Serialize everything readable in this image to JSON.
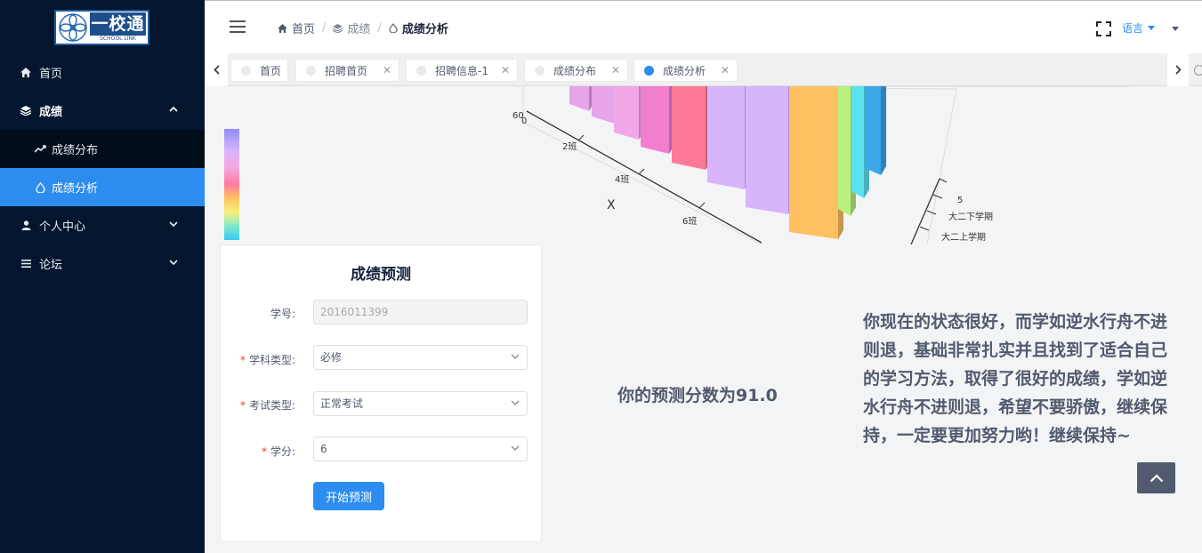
{
  "logo": {
    "main_text": "一校通",
    "sub_text": "SCHOOL LINK"
  },
  "sidebar": {
    "items": [
      {
        "label": "首页",
        "icon": "home-icon"
      },
      {
        "label": "成绩",
        "icon": "layers-icon"
      },
      {
        "label": "成绩分布",
        "icon": "trend-icon"
      },
      {
        "label": "成绩分析",
        "icon": "drop-icon"
      },
      {
        "label": "个人中心",
        "icon": "user-icon"
      },
      {
        "label": "论坛",
        "icon": "list-icon"
      }
    ]
  },
  "header": {
    "breadcrumb": [
      "首页",
      "成绩",
      "成绩分析"
    ],
    "language_label": "语言"
  },
  "tabs": [
    {
      "label": "首页",
      "active": false
    },
    {
      "label": "招聘首页",
      "active": false
    },
    {
      "label": "招聘信息-1",
      "active": false
    },
    {
      "label": "成绩分布",
      "active": false
    },
    {
      "label": "成绩分析",
      "active": true
    }
  ],
  "chart": {
    "z_tick_top": "60",
    "zero_tick": "0",
    "x_ticks": [
      "2班",
      "4班",
      "6班"
    ],
    "x_label": "X",
    "y_tick": "5",
    "y_labels": [
      "大二下学期",
      "大二上学期"
    ],
    "bar_colors": [
      "#e8a4e8",
      "#e8a4e8",
      "#f0a8e8",
      "#f07fd0",
      "#ff7a9a",
      "#d8b4fc",
      "#d8b4fc",
      "#ffc062",
      "#b8f080",
      "#5ae2f0",
      "#3aa8e8"
    ]
  },
  "form": {
    "title": "成绩预测",
    "student_id_label": "学号:",
    "student_id_value": "2016011399",
    "subject_type_label": "学科类型:",
    "subject_type_value": "必修",
    "exam_type_label": "考试类型:",
    "exam_type_value": "正常考试",
    "credit_label": "学分:",
    "credit_value": "6",
    "submit_label": "开始预测"
  },
  "result": {
    "score_text": "你的预测分数为91.0",
    "advice_text": "你现在的状态很好，而学如逆水行舟不进则退，基础非常扎实并且找到了适合自己的学习方法，取得了很好的成绩，学如逆水行舟不进则退，希望不要骄傲，继续保持，一定要更加努力哟！继续保持~"
  },
  "colors": {
    "accent": "#2d8cf0",
    "sidebar_bg": "#03162d"
  }
}
